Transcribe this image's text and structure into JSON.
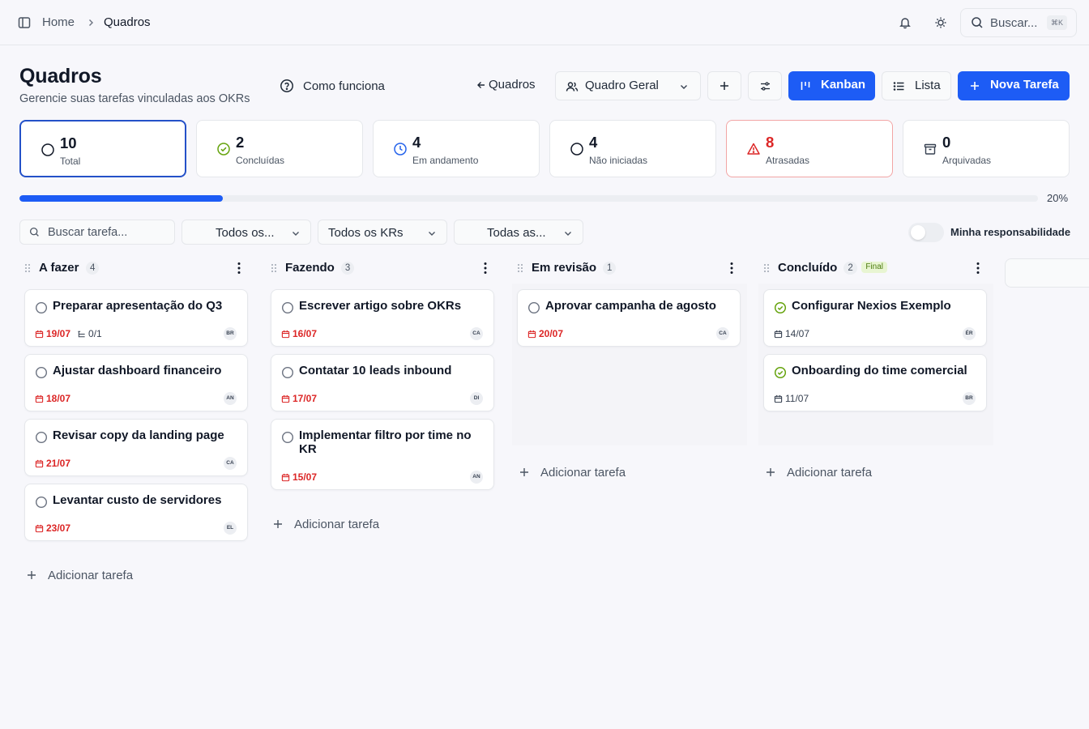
{
  "breadcrumb": {
    "home": "Home",
    "current": "Quadros"
  },
  "topbar": {
    "search_placeholder": "Buscar...",
    "shortcut": "⌘K"
  },
  "header": {
    "title": "Quadros",
    "subtitle": "Gerencie suas tarefas vinculadas aos OKRs",
    "how_it_works": "Como funciona",
    "back_label": "Quadros",
    "board_select": "Quadro Geral",
    "view_kanban": "Kanban",
    "view_list": "Lista",
    "new_task": "Nova Tarefa"
  },
  "stats": [
    {
      "value": "10",
      "label": "Total",
      "icon": "circle-icon"
    },
    {
      "value": "2",
      "label": "Concluídas",
      "icon": "check-circle-icon"
    },
    {
      "value": "4",
      "label": "Em andamento",
      "icon": "clock-icon"
    },
    {
      "value": "4",
      "label": "Não iniciadas",
      "icon": "circle-icon"
    },
    {
      "value": "8",
      "label": "Atrasadas",
      "icon": "alert-triangle-icon"
    },
    {
      "value": "0",
      "label": "Arquivadas",
      "icon": "archive-icon"
    }
  ],
  "progress": {
    "value": 0.2,
    "label": "20%"
  },
  "filters": {
    "search_placeholder": "Buscar tarefa...",
    "responsible": "Todos os...",
    "krs": "Todos os KRs",
    "third": "Todas as...",
    "toggle_label": "Minha responsabilidade",
    "toggle_on": false
  },
  "add_task_label": "Adicionar tarefa",
  "columns": [
    {
      "title": "A fazer",
      "count": "4",
      "badge": "",
      "cards": [
        {
          "title": "Preparar apresentação do Q3",
          "date": "19/07",
          "overdue": true,
          "subtasks": "0/1",
          "avatar": "BR",
          "done": false
        },
        {
          "title": "Ajustar dashboard financeiro",
          "date": "18/07",
          "overdue": true,
          "subtasks": "",
          "avatar": "AN",
          "done": false
        },
        {
          "title": "Revisar copy da landing page",
          "date": "21/07",
          "overdue": true,
          "subtasks": "",
          "avatar": "CA",
          "done": false
        },
        {
          "title": "Levantar custo de servidores",
          "date": "23/07",
          "overdue": true,
          "subtasks": "",
          "avatar": "EL",
          "done": false
        }
      ]
    },
    {
      "title": "Fazendo",
      "count": "3",
      "badge": "",
      "cards": [
        {
          "title": "Escrever artigo sobre OKRs",
          "date": "16/07",
          "overdue": true,
          "subtasks": "",
          "avatar": "CA",
          "done": false
        },
        {
          "title": "Contatar 10 leads inbound",
          "date": "17/07",
          "overdue": true,
          "subtasks": "",
          "avatar": "DI",
          "done": false
        },
        {
          "title": "Implementar filtro por time no KR",
          "date": "15/07",
          "overdue": true,
          "subtasks": "",
          "avatar": "AN",
          "done": false
        }
      ]
    },
    {
      "title": "Em revisão",
      "count": "1",
      "badge": "",
      "cards": [
        {
          "title": "Aprovar campanha de agosto",
          "date": "20/07",
          "overdue": true,
          "subtasks": "",
          "avatar": "CA",
          "done": false
        }
      ]
    },
    {
      "title": "Concluído",
      "count": "2",
      "badge": "Final",
      "cards": [
        {
          "title": "Configurar Nexios Exemplo",
          "date": "14/07",
          "overdue": false,
          "subtasks": "",
          "avatar": "ÉR",
          "done": true
        },
        {
          "title": "Onboarding do time comercial",
          "date": "11/07",
          "overdue": false,
          "subtasks": "",
          "avatar": "BR",
          "done": true
        }
      ]
    }
  ],
  "colors": {
    "primary": "#1d5cf5",
    "overdue": "#dc2626",
    "done": "#65a30d",
    "background": "#f7f7fb"
  }
}
